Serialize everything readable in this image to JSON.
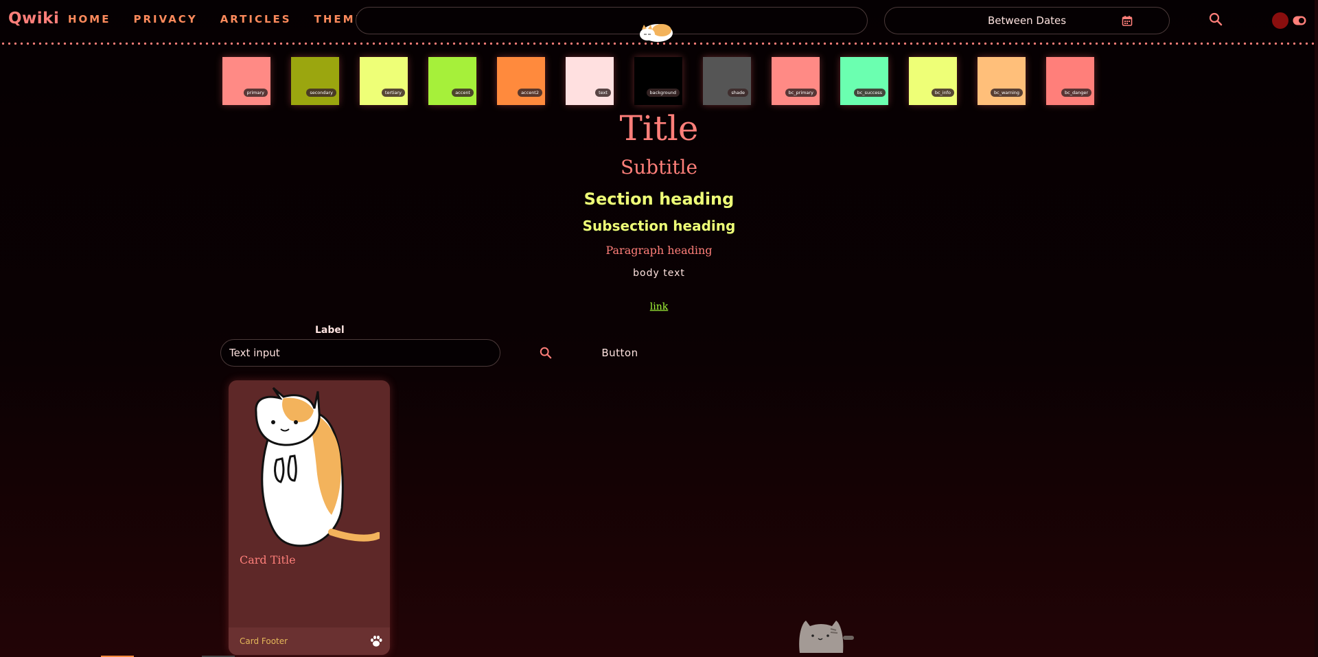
{
  "navbar": {
    "brand": "Qwiki",
    "links": [
      "HOME",
      "PRIVACY",
      "ARTICLES",
      "THEME"
    ],
    "search_placeholder": "",
    "date_range_label": "Between Dates"
  },
  "swatches": [
    {
      "label": "primary",
      "color": "#ff8a85"
    },
    {
      "label": "secondary",
      "color": "#9ba60f"
    },
    {
      "label": "tertiary",
      "color": "#eeff77"
    },
    {
      "label": "accent",
      "color": "#a6f03a"
    },
    {
      "label": "accent2",
      "color": "#ff8a3d"
    },
    {
      "label": "text",
      "color": "#ffe0e0"
    },
    {
      "label": "background",
      "color": "#000000"
    },
    {
      "label": "shade",
      "color": "#555555"
    },
    {
      "label": "bc_primary",
      "color": "#ff8a85"
    },
    {
      "label": "bc_success",
      "color": "#6bffb0"
    },
    {
      "label": "bc_info",
      "color": "#eeff77"
    },
    {
      "label": "bc_warning",
      "color": "#ffbf7a"
    },
    {
      "label": "bc_danger",
      "color": "#ff7f7a"
    }
  ],
  "typography": {
    "title": "Title",
    "subtitle": "Subtitle",
    "section": "Section heading",
    "subsection": "Subsection heading",
    "paragraph": "Paragraph heading",
    "body": "body text",
    "link": "link"
  },
  "form": {
    "label": "Label",
    "input_value": "Text input",
    "button": "Button"
  },
  "card": {
    "title": "Card Title",
    "footer": "Card Footer"
  },
  "icons": {
    "calendar": "calendar-icon",
    "search": "search-icon",
    "toggle": "theme-toggle-icon",
    "paw": "paw-icon"
  }
}
